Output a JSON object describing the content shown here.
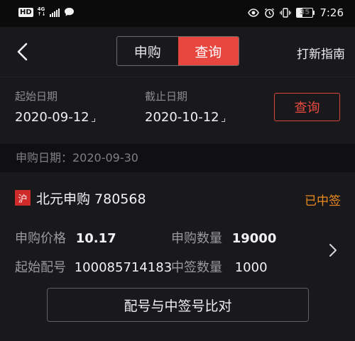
{
  "status_bar": {
    "hd_label": "HD",
    "network_label": "4G",
    "battery_percent": "35",
    "time": "7:26"
  },
  "header": {
    "tabs": [
      {
        "label": "申购",
        "active": false
      },
      {
        "label": "查询",
        "active": true
      }
    ],
    "guide_link": "打新指南"
  },
  "filter": {
    "start_label": "起始日期",
    "start_date": "2020-09-12",
    "end_label": "截止日期",
    "end_date": "2020-10-12",
    "query_button": "查询"
  },
  "section": {
    "date_text": "申购日期：2020-09-30"
  },
  "record": {
    "market_badge": "沪",
    "stock_name": "北元申购 780568",
    "status": "已中签",
    "price_label": "申购价格",
    "price_value": "10.17",
    "qty_label": "申购数量",
    "qty_value": "19000",
    "start_no_label": "起始配号",
    "start_no_value": "100085714183",
    "win_qty_label": "中签数量",
    "win_qty_value": "1000",
    "compare_button": "配号与中签号比对"
  },
  "colors": {
    "accent_red": "#e8473f",
    "status_orange": "#f08c1e",
    "background": "#141416"
  }
}
